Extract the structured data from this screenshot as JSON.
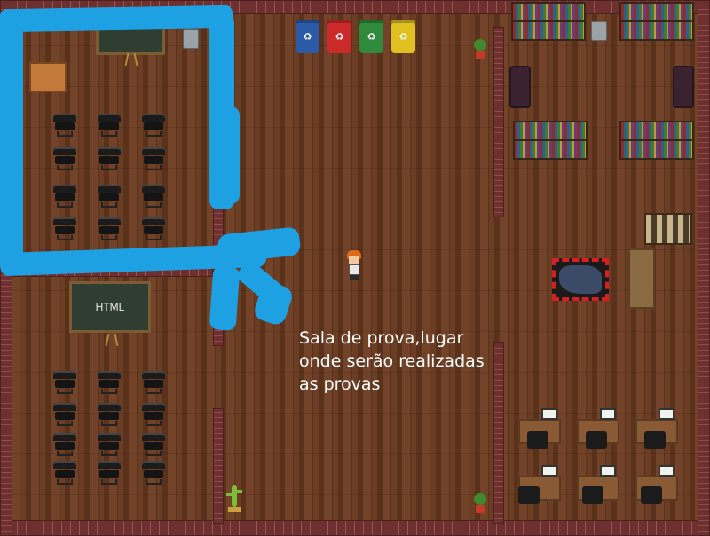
{
  "map": {
    "classroom_board_label": "",
    "html_board_label": "HTML",
    "recycle_bins": [
      {
        "color": "#2a5aa8",
        "icon": "recycle-icon",
        "glyph": "♻"
      },
      {
        "color": "#cc2a2a",
        "icon": "recycle-icon",
        "glyph": "♻"
      },
      {
        "color": "#2f8a3c",
        "icon": "recycle-icon",
        "glyph": "♻"
      },
      {
        "color": "#e0c020",
        "icon": "recycle-icon",
        "glyph": "♻"
      }
    ],
    "annotation": {
      "line1": "Sala de prova,lugar",
      "line2": "onde serão realizadas",
      "line3": "as provas"
    },
    "colors": {
      "annotation_brush": "#1da1e2",
      "floor": "#6b3d23",
      "wall": "#7a3a3a"
    }
  }
}
